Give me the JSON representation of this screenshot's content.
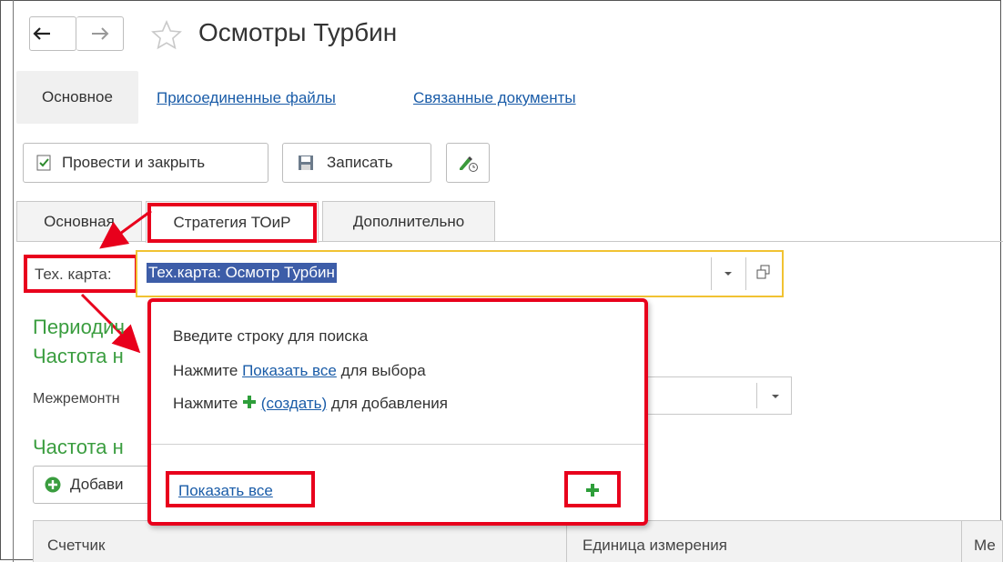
{
  "window": {
    "title": "Осмотры Турбин",
    "back_icon": "arrow-left",
    "forward_icon": "arrow-right",
    "favorite_icon": "star-outline"
  },
  "nav_tabs": {
    "main": "Основное",
    "attached_files": "Присоединенные файлы",
    "related_docs": "Связанные документы"
  },
  "toolbar": {
    "post_close": "Провести и закрыть",
    "save": "Записать"
  },
  "form_tabs": {
    "basic": "Основная",
    "strategy": "Стратегия ТОиР",
    "extra": "Дополнительно"
  },
  "tech_card": {
    "label": "Тех. карта:",
    "value": "Тех.карта: Осмотр Турбин"
  },
  "section": {
    "periodic": "Периодич",
    "freq1": "Частота н",
    "interrepair": "Межремонтн",
    "freq2": "Частота н",
    "add_button": "Добави"
  },
  "popup": {
    "line1": "Введите строку для поиска",
    "line2_pre": "Нажмите ",
    "line2_link": "Показать все",
    "line2_post": " для выбора",
    "line3_pre": "Нажмите ",
    "line3_link": "(создать)",
    "line3_post": " для добавления",
    "show_all": "Показать все"
  },
  "grid": {
    "col_counter": "Счетчик",
    "col_unit": "Единица измерения",
    "col_third": "Ме"
  },
  "colors": {
    "highlight_red": "#e8001c",
    "link_blue": "#1a5ca8",
    "green": "#3a9d3f",
    "focus_yellow": "#f1c232"
  }
}
